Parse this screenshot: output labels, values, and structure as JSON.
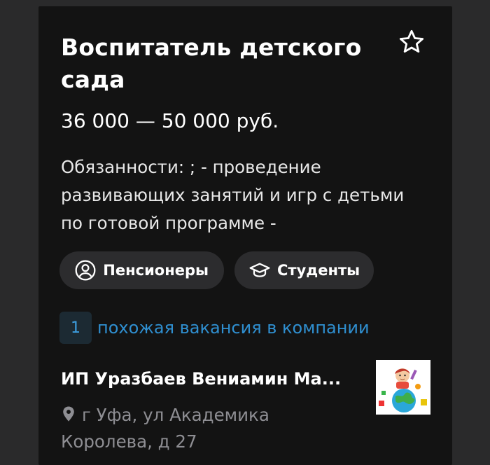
{
  "vacancy": {
    "title": "Воспитатель детского сада",
    "salary": "36 000 — 50 000 руб.",
    "description": "Обязанности: ; - проведение развивающих занятий и игр с детьми по готовой программе -"
  },
  "tags": [
    {
      "label": "Пенсионеры",
      "icon": "person-circle-icon"
    },
    {
      "label": "Студенты",
      "icon": "graduation-cap-icon"
    }
  ],
  "similar": {
    "count": "1",
    "label": "похожая вакансия в компании"
  },
  "company": {
    "name": "ИП Уразбаев Вениамин Ма...",
    "address": "г Уфа, ул Академика Королева, д 27"
  },
  "colors": {
    "background": "#2a2a2b",
    "card": "#131313",
    "chip": "#2c2c2e",
    "link": "#2f8fd0",
    "muted": "#8e8e93"
  }
}
